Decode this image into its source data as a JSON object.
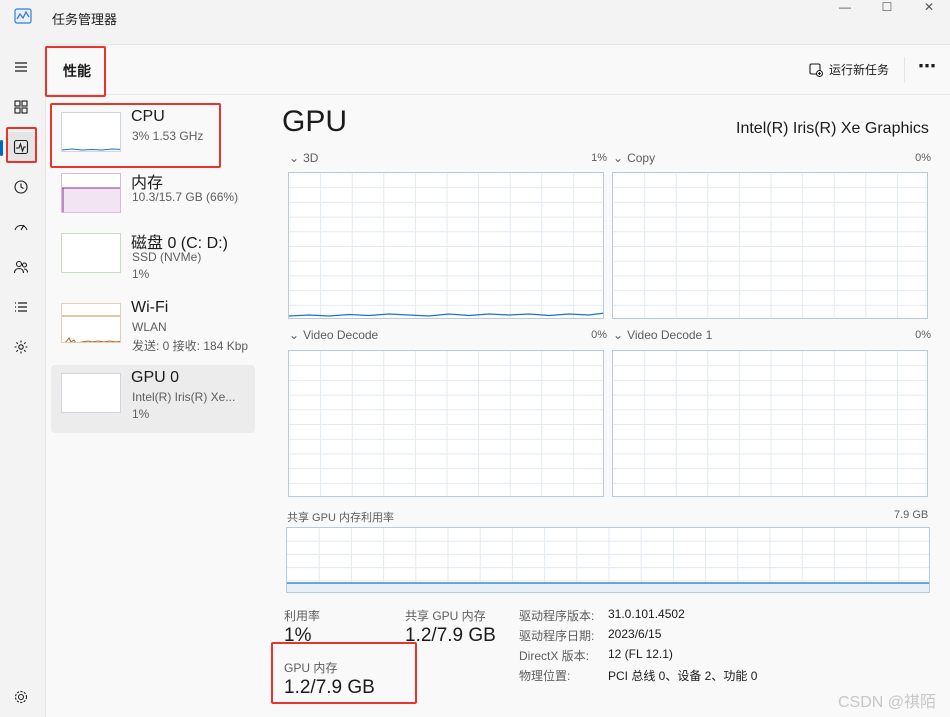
{
  "window": {
    "title": "任务管理器",
    "icon": "chart-icon",
    "controls": [
      "minimize-icon",
      "maximize-icon",
      "close-icon"
    ]
  },
  "nav": {
    "icons": [
      "hamburger-icon",
      "processes-icon",
      "performance-icon",
      "history-icon",
      "startup-icon",
      "users-icon",
      "details-icon",
      "services-icon",
      "settings-icon"
    ],
    "active": "performance-icon",
    "accent": "#0067c0"
  },
  "header": {
    "title": "性能",
    "run_task": "运行新任务",
    "more": "⋯"
  },
  "devices": [
    {
      "name": "CPU",
      "line1": "3%  1.53 GHz",
      "line2": "",
      "usage": 0.03,
      "color": "#1f6fd0"
    },
    {
      "name": "内存",
      "line1": "10.3/15.7 GB (66%)",
      "line2": "",
      "usage": 0.66,
      "color": "#8b2a9b"
    },
    {
      "name": "磁盘 0 (C: D:)",
      "line1": "SSD (NVMe)",
      "line2": "1%",
      "usage": 0.01,
      "color": "#4f9e3a"
    },
    {
      "name": "Wi-Fi",
      "line1": "WLAN",
      "line2": "发送: 0  接收: 184 Kbp",
      "usage": 0.2,
      "color": "#b5651d"
    },
    {
      "name": "GPU 0",
      "line1": "Intel(R) Iris(R) Xe...",
      "line2": "1%",
      "usage": 0.01,
      "color": "#1f6fd0"
    }
  ],
  "gpu": {
    "title": "GPU",
    "model": "Intel(R) Iris(R) Xe Graphics",
    "engines": [
      {
        "name": "3D",
        "pct": "1%"
      },
      {
        "name": "Copy",
        "pct": "0%"
      },
      {
        "name": "Video Decode",
        "pct": "0%"
      },
      {
        "name": "Video Decode 1",
        "pct": "0%"
      }
    ],
    "shared_mem_label": "共享 GPU 内存利用率",
    "shared_mem_max": "7.9 GB",
    "stats": {
      "util_label": "利用率",
      "util_value": "1%",
      "shared_label": "共享 GPU 内存",
      "shared_value": "1.2/7.9 GB",
      "gpu_mem_label": "GPU 内存",
      "gpu_mem_value": "1.2/7.9 GB"
    },
    "info": [
      {
        "k": "驱动程序版本:",
        "v": "31.0.101.4502"
      },
      {
        "k": "驱动程序日期:",
        "v": "2023/6/15"
      },
      {
        "k": "DirectX 版本:",
        "v": "12 (FL 12.1)"
      },
      {
        "k": "物理位置:",
        "v": "PCI 总线 0、设备 2、功能 0"
      }
    ]
  },
  "watermark": "CSDN @祺陌",
  "colors": {
    "annotation": "#e8342b",
    "graph_line": "#1f6fd0",
    "graph_border": "#b9c9de"
  }
}
